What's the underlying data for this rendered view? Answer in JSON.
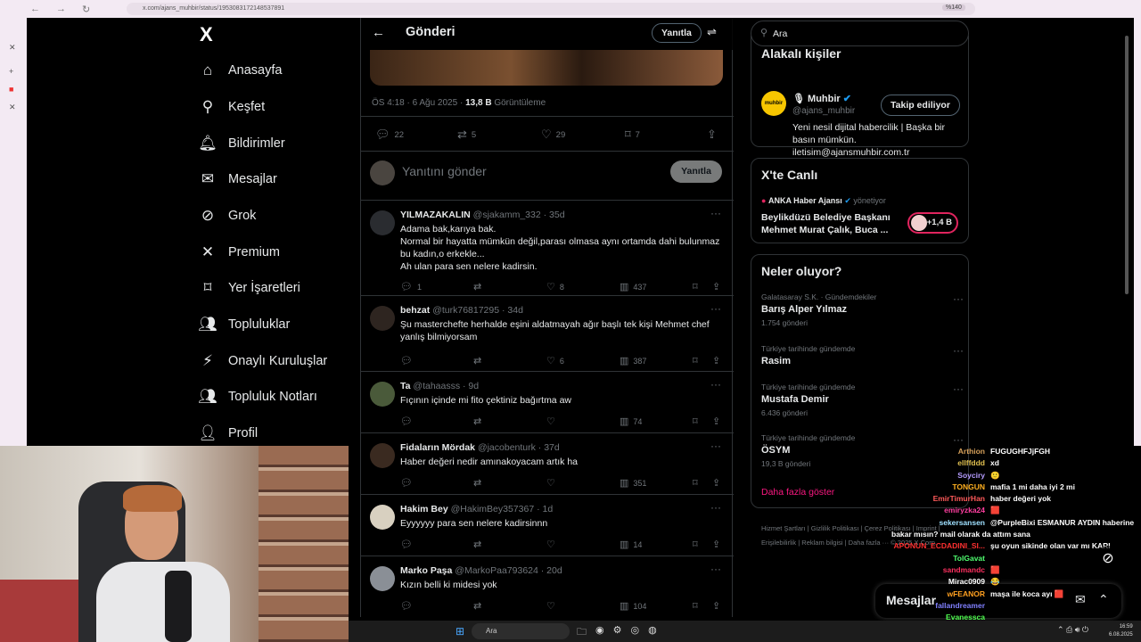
{
  "browser": {
    "url": "x.com/ajans_muhbir/status/1953083172148537891",
    "zoom": "%140"
  },
  "nav": {
    "logo": "X",
    "items": [
      {
        "label": "Anasayfa",
        "icon": "home-icon"
      },
      {
        "label": "Keşfet",
        "icon": "search-icon"
      },
      {
        "label": "Bildirimler",
        "icon": "bell-icon"
      },
      {
        "label": "Mesajlar",
        "icon": "mail-icon"
      },
      {
        "label": "Grok",
        "icon": "grok-icon"
      },
      {
        "label": "Premium",
        "icon": "x-icon"
      },
      {
        "label": "Yer İşaretleri",
        "icon": "bookmark-icon"
      },
      {
        "label": "Topluluklar",
        "icon": "people-icon"
      },
      {
        "label": "Onaylı Kuruluşlar",
        "icon": "lightning-icon"
      },
      {
        "label": "Topluluk Notları",
        "icon": "notes-icon"
      },
      {
        "label": "Profil",
        "icon": "profile-icon"
      }
    ]
  },
  "post": {
    "header_title": "Gönderi",
    "reply_button": "Yanıtla",
    "timestamp": "ÖS 4:18 · 6 Ağu 2025 · ",
    "views": "13,8 B",
    "views_label": " Görüntüleme",
    "stats": {
      "replies": "22",
      "reposts": "5",
      "likes": "29",
      "bookmarks": "7"
    },
    "compose_placeholder": "Yanıtını gönder",
    "compose_button": "Yanıtla"
  },
  "replies": [
    {
      "name": "YILMAZAKALIN",
      "handle": "@sjakamm_332 · 35d",
      "text": "Adama bak,karıya bak.\nNormal bir hayatta mümkün değil,parası olmasa aynı ortamda dahi bulunmaz bu kadın,o erkekle...\nAh ulan para sen nelere kadirsin.",
      "replies": "1",
      "likes": "8",
      "views": "437"
    },
    {
      "name": "behzat",
      "handle": "@turk76817295 · 34d",
      "text": "Şu masterchefte herhalde eşini aldatmayah ağır başlı tek kişi Mehmet chef yanlış bilmiyorsam",
      "replies": "",
      "likes": "6",
      "views": "387"
    },
    {
      "name": "Ta",
      "handle": "@tahaasss · 9d",
      "text": "Fıçının içinde mi fito çektiniz bağırtma aw",
      "replies": "",
      "likes": "",
      "views": "74"
    },
    {
      "name": "Fidaların Mördak",
      "handle": "@jacobenturk · 37d",
      "text": "Haber değeri nedir amınakoyacam artık ha",
      "replies": "",
      "likes": "",
      "views": "351"
    },
    {
      "name": "Hakim Bey",
      "handle": "@HakimBey357367 · 1d",
      "text": "Eyyyyyy para sen nelere kadirsinnn",
      "replies": "",
      "likes": "",
      "views": "14"
    },
    {
      "name": "Marko Paşa",
      "handle": "@MarkoPaa793624 · 20d",
      "text": "Kızın belli ki midesi yok",
      "replies": "",
      "likes": "",
      "views": "104"
    }
  ],
  "right": {
    "search_value": "Ara",
    "related_title": "Alakalı kişiler",
    "related": {
      "name": "Muhbir",
      "handle": "@ajans_muhbir",
      "follow": "Takip ediliyor",
      "bio": "Yeni nesil dijital habercilik | Başka bir basın mümkün.\niletisim@ajansmuhbir.com.tr"
    },
    "live_title": "X'te Canlı",
    "live": {
      "host": "ANKA Haber Ajansı",
      "role": "yönetiyor",
      "text": "Beylikdüzü Belediye Başkanı Mehmet Murat Çalık, Buca ...",
      "count": "+1,4 B"
    },
    "trends_title": "Neler oluyor?",
    "trends": [
      {
        "context": "Galatasaray S.K. · Gündemdekiler",
        "name": "Barış Alper Yılmaz",
        "posts": "1.754 gönderi"
      },
      {
        "context": "Türkiye tarihinde gündemde",
        "name": "Rasim",
        "posts": ""
      },
      {
        "context": "Türkiye tarihinde gündemde",
        "name": "Mustafa Demir",
        "posts": "6.436 gönderi"
      },
      {
        "context": "Türkiye tarihinde gündemde",
        "name": "ÖSYM",
        "posts": "19,3 B gönderi"
      }
    ],
    "show_more": "Daha fazla göster",
    "footer": "Hizmet Şartları | Gizlilik Politikası | Çerez Politikası | Imprint | Erişilebilirlik | Reklam bilgisi | Daha fazla ··· © 2025 X Corp."
  },
  "messages_bar": {
    "title": "Mesajlar"
  },
  "chat": [
    {
      "user": "Arthion",
      "color": "#d6a05a",
      "msg": "FUGUGHFJjFGH"
    },
    {
      "user": "ellffddd",
      "color": "#e0c050",
      "msg": "xd"
    },
    {
      "user": "Soyciry",
      "color": "#b59cff",
      "msg": "🙂"
    },
    {
      "user": "TONGUN",
      "color": "#ffb020",
      "msg": "mafia 1 mi daha iyi 2 mi"
    },
    {
      "user": "EmirTimurHan",
      "color": "#ff5a5a",
      "msg": "haber değeri yok"
    },
    {
      "user": "emiryzka24",
      "color": "#ff3fa0",
      "msg": "🟥"
    },
    {
      "user": "sekersansen",
      "color": "#9fe0ff",
      "msg": "@PurpleBixi ESMANUR AYDIN haberine bakar mısın? mail olarak da attım sana"
    },
    {
      "user": "APONUN_ECDADINI_SI...",
      "color": "#ff3030",
      "msg": "şu oyun sikinde olan var mı KARI"
    },
    {
      "user": "TolGavat",
      "color": "#50ff70",
      "msg": ""
    },
    {
      "user": "sandmandc",
      "color": "#ff3060",
      "msg": "🟥"
    },
    {
      "user": "Mirac0909",
      "color": "#fff",
      "msg": "😂"
    },
    {
      "user": "wFEANOR",
      "color": "#ffa020",
      "msg": "maşa ile koca ayı 🟥"
    },
    {
      "user": "fallandreamer",
      "color": "#8080ff",
      "msg": ""
    },
    {
      "user": "Evanessca",
      "color": "#50ff50",
      "msg": ""
    }
  ],
  "taskbar": {
    "search": "Ara",
    "time": "16:59",
    "date": "6.08.2025"
  }
}
